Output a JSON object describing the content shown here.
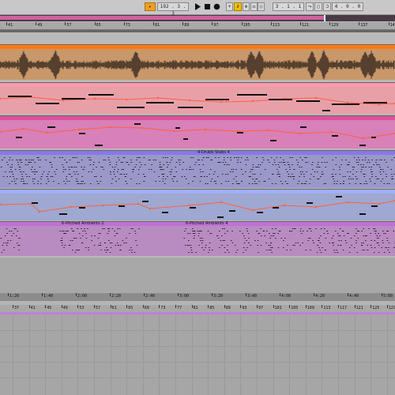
{
  "transport": {
    "tempo": "192 .  3 .  3",
    "position": "3 .  1 .  1",
    "loop_length": "4 .  0 .  0"
  },
  "ruler_top": [
    "41",
    "49",
    "57",
    "65",
    "73",
    "81",
    "89",
    "97",
    "105",
    "113",
    "121",
    "129",
    "137",
    "145"
  ],
  "clips": {
    "drum_stabs": "4-Drubb Stabs 4",
    "ambient_2": "6-Pitched Ambients 2",
    "ambient_4": "6-Pitched Ambients 4"
  },
  "ruler_time": [
    "1:20",
    "1:40",
    "2:00",
    "2:20",
    "2:40",
    "3:00",
    "3:20",
    "3:40",
    "4:00",
    "4:20",
    "4:40",
    "5:00"
  ],
  "ruler_bottom": [
    "37",
    "41",
    "45",
    "49",
    "53",
    "57",
    "61",
    "65",
    "69",
    "73",
    "77",
    "81",
    "85",
    "89",
    "93",
    "97",
    "101",
    "105",
    "109",
    "113",
    "117",
    "121",
    "125",
    "129"
  ],
  "colors": {
    "audio_track": "#e8883a",
    "pink_track": "#f0a8b8",
    "magenta_track": "#e060a8",
    "purple_track": "#9080e0",
    "blue_track": "#a8b0e8",
    "violet_track": "#c070d0",
    "envelope": "#ff6040"
  }
}
